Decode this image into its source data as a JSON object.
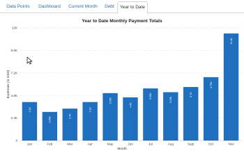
{
  "tabs": [
    {
      "label": "Data Points",
      "active": false
    },
    {
      "label": "Dashboard",
      "active": false
    },
    {
      "label": "Current Month",
      "active": false
    },
    {
      "label": "Debt",
      "active": false
    },
    {
      "label": "Year to Date",
      "active": true
    }
  ],
  "colors": {
    "bar": "#1f6fbf",
    "grid": "#e3e3e3",
    "tab_text": "#2f6ea8"
  },
  "chart_data": {
    "type": "bar",
    "title": "Year to Date Monthly Payment Totals",
    "xlabel": "Month",
    "ylabel": "Expenses (in USD)",
    "ylim": [
      0,
      12000
    ],
    "yticks": [
      0,
      2400,
      4800,
      7200,
      9600,
      12000
    ],
    "ytick_labels": [
      "0",
      "2.4K",
      "4.8K",
      "7.2K",
      "9.6K",
      "12K"
    ],
    "grid": true,
    "categories": [
      "Jan",
      "Feb",
      "Mar",
      "Apr",
      "May",
      "Jun",
      "Jul",
      "Aug",
      "Sept",
      "Oct",
      "Nov"
    ],
    "values": [
      4100,
      3050,
      3400,
      4100,
      5050,
      4600,
      5550,
      5150,
      5700,
      6750,
      11400
    ],
    "data_labels": [
      "4.1K",
      "3.05K",
      "3.4K",
      "4.1K",
      "5.05K",
      "4.6K",
      "5.55K",
      "5.15K",
      "5.7K",
      "6.75K",
      "11.4K"
    ]
  }
}
